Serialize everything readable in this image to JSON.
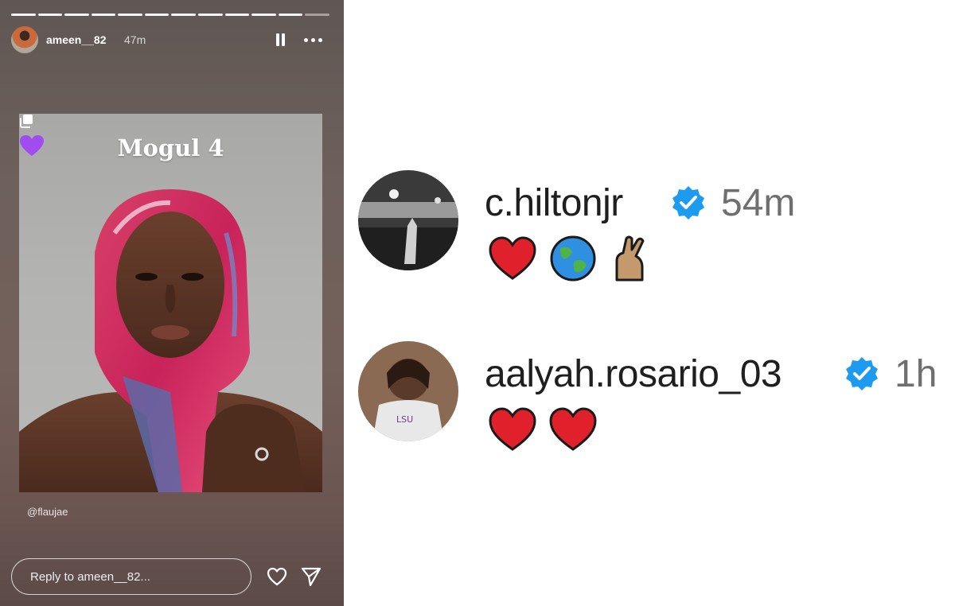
{
  "story": {
    "author": "ameen__82",
    "posted": "47m",
    "progress_segments": 12,
    "card": {
      "title": "Mogul 4",
      "title_emoji": "purple-heart",
      "mention": "@flaujae"
    },
    "reply_placeholder": "Reply to ameen__82..."
  },
  "comments": [
    {
      "username": "c.hiltonjr",
      "verified": true,
      "time": "54m",
      "reactions": [
        "red-heart",
        "globe",
        "crossed-fingers"
      ]
    },
    {
      "username": "aalyah.rosario_03",
      "verified": true,
      "time": "1h",
      "reactions": [
        "red-heart",
        "red-heart"
      ]
    }
  ],
  "colors": {
    "verified_blue": "#1d9bf0",
    "heart_red": "#e0202b"
  }
}
